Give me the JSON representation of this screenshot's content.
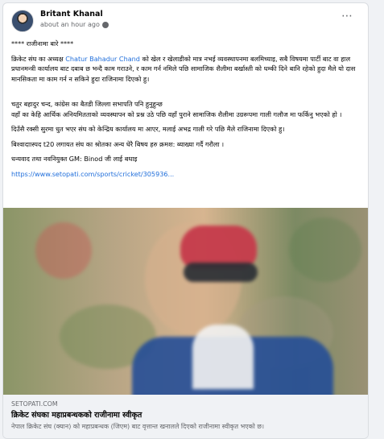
{
  "post": {
    "author": "Britant Khanal",
    "time": "about an hour ago",
    "paragraphs": [
      {
        "before": "**** राजीनामा बारे ****",
        "mention": "",
        "after": ""
      },
      {
        "before": "क्रिकेट संघ का अध्यक्ष ",
        "mention": "Chatur Bahadur Chand",
        "after": " को खेल र खेलाडीको मात्र नभई व्यवस्थापनमा बलमिच्याइ, सबै विषयमा पार्टी बाट वा हाल प्रधानमन्त्री कार्यालय बाट दबाब छ भन्दै  काम गराउने, र काम गर्न नमिले पछि सामाजिक शैलीमा  बर्खास्ती को धम्की दिने बानि रहेको हुदा मैले यो दास मानसिकता मा काम गर्न न सकिने हुदा राजिनामा दिएको हु।"
      },
      {
        "before": "चतुर बहादुर चन्द, कांग्रेस का बैतडी जिल्ला सभापति पनि हुनुहुन्छ\n वहाँ का केहि आर्थिक अनियमितताको व्यवस्थापन को प्रश्न उठे पछि  वहाँ पुराने सामाजिक शैलीमा उग्ररूपमा गाली गलौज मा फर्किनु भएको हो ।",
        "mention": "",
        "after": ""
      },
      {
        "before": "दिउँसै रक्सी सुरमा धुत भएर संघ को केन्द्रिय कार्यालय मा आएर, मलाई अभद्र गाली गरे पछि मैले राजिनामा दिएको हु।",
        "mention": "",
        "after": ""
      },
      {
        "before": "बिश्वादाास्पद t20 लगायत संघ का श्रोतका  अन्य धेरै बिषय हरु क्रमश: ब्याख्या गर्दै गरौला ।",
        "mention": "",
        "after": ""
      },
      {
        "before": " धन्यवाद तथा नवनियुक्त GM: Binod जी लाई बधाइ",
        "mention": "",
        "after": ""
      }
    ],
    "link": "https://www.setopati.com/sports/cricket/305936..."
  },
  "preview": {
    "source": "SETOPATI.COM",
    "title": "क्रिकेट संघका महाप्रबन्धकको राजीनामा स्वीकृत",
    "description": "नेपाल क्रिकेट संघ (क्यान) को महाप्रबन्धक (जिएम) बाट वृत्तान्त खनालले दिएको राजीनामा स्वीकृत भएको छ।"
  },
  "icons": {
    "menu": "more-options-icon",
    "privacy": "globe-icon"
  }
}
